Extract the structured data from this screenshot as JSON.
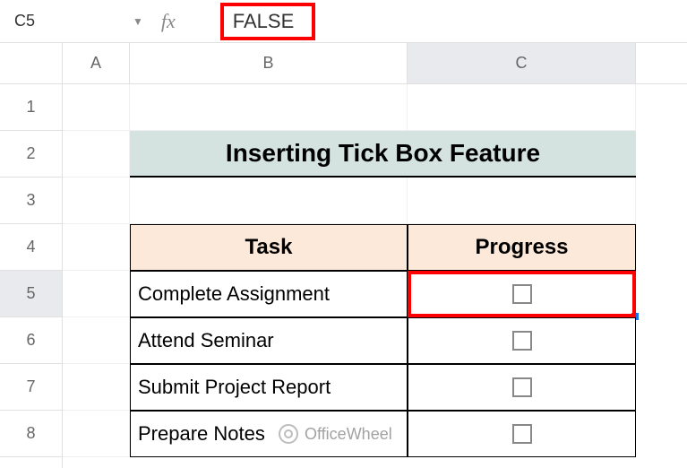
{
  "formulaBar": {
    "cellRef": "C5",
    "fxLabel": "fx",
    "value": "FALSE"
  },
  "columns": {
    "A": "A",
    "B": "B",
    "C": "C"
  },
  "rows": {
    "r1": "1",
    "r2": "2",
    "r3": "3",
    "r4": "4",
    "r5": "5",
    "r6": "6",
    "r7": "7",
    "r8": "8"
  },
  "content": {
    "title": "Inserting Tick Box Feature",
    "headers": {
      "task": "Task",
      "progress": "Progress"
    },
    "tasks": {
      "t1": "Complete Assignment",
      "t2": "Attend Seminar",
      "t3": "Submit Project Report",
      "t4": "Prepare Notes"
    }
  },
  "watermark": {
    "text": "OfficeWheel"
  },
  "chart_data": {
    "type": "table",
    "title": "Inserting Tick Box Feature",
    "columns": [
      "Task",
      "Progress"
    ],
    "rows": [
      {
        "Task": "Complete Assignment",
        "Progress": false
      },
      {
        "Task": "Attend Seminar",
        "Progress": false
      },
      {
        "Task": "Submit Project Report",
        "Progress": false
      },
      {
        "Task": "Prepare Notes",
        "Progress": false
      }
    ],
    "selected_cell": "C5",
    "selected_value": "FALSE"
  }
}
